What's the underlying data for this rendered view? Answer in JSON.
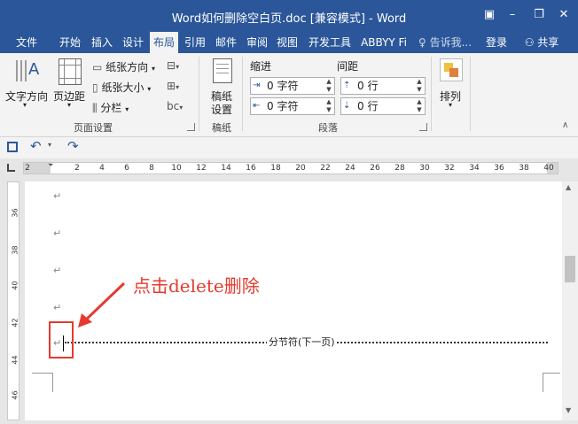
{
  "window": {
    "title": "Word如何删除空白页.doc [兼容模式] - Word"
  },
  "tabs": [
    {
      "label": "文件"
    },
    {
      "label": "开始"
    },
    {
      "label": "插入"
    },
    {
      "label": "设计"
    },
    {
      "label": "布局"
    },
    {
      "label": "引用"
    },
    {
      "label": "邮件"
    },
    {
      "label": "审阅"
    },
    {
      "label": "视图"
    },
    {
      "label": "开发工具"
    },
    {
      "label": "ABBYY Fi"
    }
  ],
  "tellme": "告诉我...",
  "login": "登录",
  "share": "共享",
  "ribbon": {
    "page_setup": {
      "text_direction": "文字方向",
      "margins": "页边距",
      "orientation": "纸张方向",
      "size": "纸张大小",
      "columns": "分栏",
      "label": "页面设置"
    },
    "draft": {
      "line1": "稿纸",
      "line2": "设置",
      "label": "稿纸"
    },
    "paragraph": {
      "indent": "缩进",
      "spacing": "间距",
      "indent_left": "0 字符",
      "indent_right": "0 字符",
      "spacing_before": "0 行",
      "spacing_after": "0 行",
      "label": "段落"
    },
    "arrange": {
      "label": "排列"
    }
  },
  "ruler": [
    "2",
    "2",
    "4",
    "6",
    "8",
    "10",
    "12",
    "14",
    "16",
    "18",
    "20",
    "22",
    "24",
    "26",
    "28",
    "30",
    "32",
    "34",
    "36",
    "38",
    "40"
  ],
  "vruler": [
    "36",
    "38",
    "40",
    "42",
    "44",
    "46"
  ],
  "document": {
    "para_mark": "↵",
    "section_break": "分节符(下一页)",
    "annotation": "点击delete删除"
  },
  "colors": {
    "accent": "#2b579a",
    "annotation": "#e53a2f"
  }
}
